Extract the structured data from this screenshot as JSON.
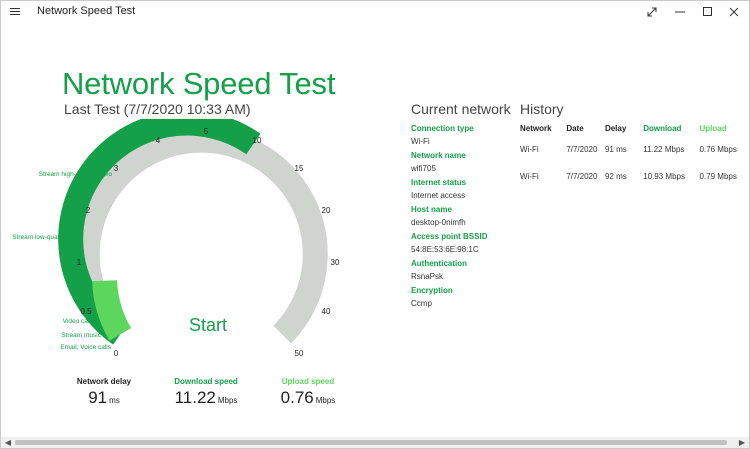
{
  "window": {
    "title": "Network Speed Test"
  },
  "header": {
    "title": "Network Speed Test",
    "last_test": "Last Test (7/7/2020 10:33 AM)"
  },
  "gauge": {
    "ticks": [
      "0",
      "0.5",
      "1",
      "2",
      "3",
      "4",
      "5",
      "10",
      "15",
      "20",
      "30",
      "40",
      "50"
    ],
    "labels": [
      "Stream high-quality video",
      "Stream low-quality video",
      "Video calls",
      "Stream music",
      "Email, Voice calls"
    ],
    "start_label": "Start",
    "colors": {
      "track": "#cfd4cf",
      "primary": "#14a049",
      "light": "#5cd65c"
    }
  },
  "metrics": {
    "delay": {
      "label": "Network delay",
      "value": "91",
      "unit": "ms"
    },
    "download": {
      "label": "Download speed",
      "value": "11.22",
      "unit": "Mbps"
    },
    "upload": {
      "label": "Upload speed",
      "value": "0.76",
      "unit": "Mbps"
    }
  },
  "current_network": {
    "title": "Current network",
    "items": [
      {
        "key": "Connection type",
        "value": "Wi-Fi"
      },
      {
        "key": "Network name",
        "value": "wifi705"
      },
      {
        "key": "Internet status",
        "value": "Internet access"
      },
      {
        "key": "Host name",
        "value": "desktop-0nimfh"
      },
      {
        "key": "Access point BSSID",
        "value": "54:8E:53:6E:98:1C"
      },
      {
        "key": "Authentication",
        "value": "RsnaPsk"
      },
      {
        "key": "Encryption",
        "value": "Ccmp"
      }
    ]
  },
  "history": {
    "title": "History",
    "columns": [
      "Network",
      "Date",
      "Delay",
      "Download",
      "Upload"
    ],
    "rows": [
      [
        "Wi-Fi",
        "7/7/2020",
        "91 ms",
        "11.22 Mbps",
        "0.76 Mbps"
      ],
      [
        "Wi-Fi",
        "7/7/2020",
        "92 ms",
        "10.93 Mbps",
        "0.79 Mbps"
      ]
    ]
  },
  "colors": {
    "accent": "#14a049",
    "accent_light": "#5cd65c"
  }
}
